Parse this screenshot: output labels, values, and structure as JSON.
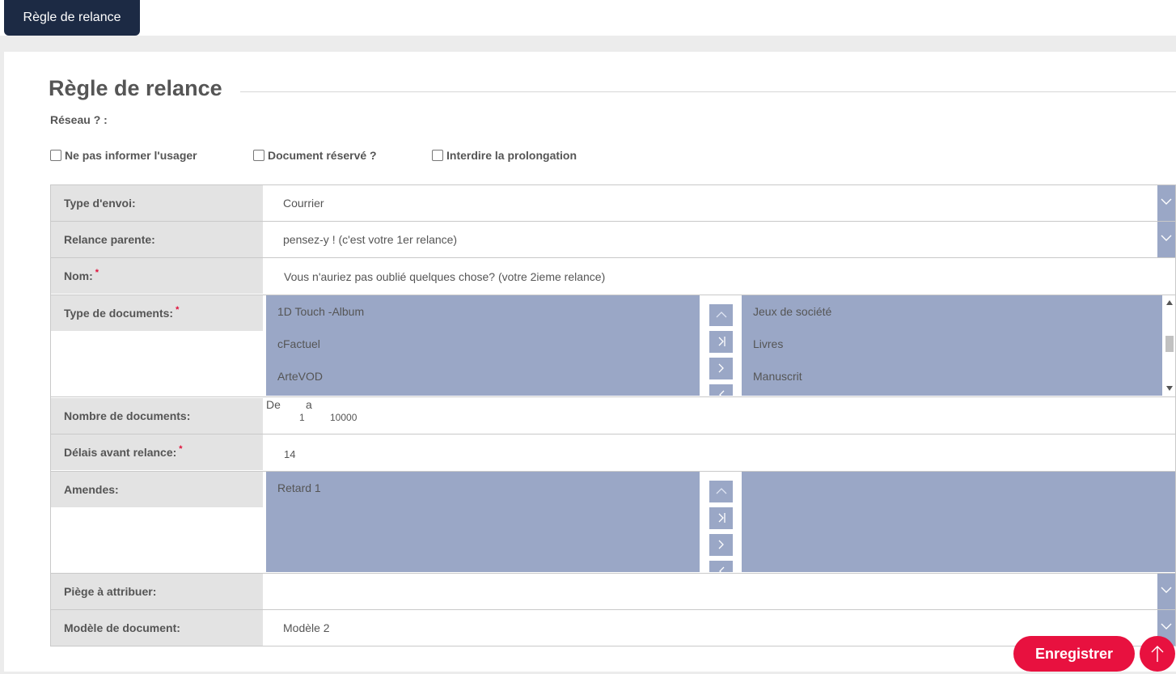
{
  "tab": {
    "label": "Règle de relance"
  },
  "page": {
    "title": "Règle de relance",
    "reseau_label": "Réseau ? :"
  },
  "checkboxes": [
    {
      "label": "Ne pas informer l'usager",
      "checked": false
    },
    {
      "label": "Document réservé ?",
      "checked": false
    },
    {
      "label": "Interdire la prolongation",
      "checked": false
    }
  ],
  "fields": {
    "type_envoi": {
      "label": "Type d'envoi:",
      "value": "Courrier"
    },
    "relance_parente": {
      "label": "Relance parente:",
      "value": "pensez-y !  (c'est votre 1er relance)"
    },
    "nom": {
      "label": "Nom:",
      "required": "*",
      "value": "Vous n'auriez pas oublié quelques chose?  (votre 2ieme relance)"
    },
    "type_documents": {
      "label": "Type de documents:",
      "required": "*",
      "available": [
        "1D Touch -Album",
        "cFactuel",
        "ArteVOD"
      ],
      "selected": [
        "Jeux de société",
        "Livres",
        "Manuscrit"
      ]
    },
    "nombre_documents": {
      "label": "Nombre de documents:",
      "from_label": "De",
      "to_label": "a",
      "from_value": "1",
      "to_value": "10000"
    },
    "delais": {
      "label": "Délais avant relance:",
      "required": "*",
      "value": "14"
    },
    "amendes": {
      "label": "Amendes:",
      "available": [
        "Retard 1"
      ],
      "selected": []
    },
    "piege": {
      "label": "Piège à attribuer:",
      "value": ""
    },
    "modele": {
      "label": "Modèle de document:",
      "value": "Modèle 2"
    }
  },
  "actions": {
    "save_label": "Enregistrer"
  },
  "colors": {
    "navy": "#1c2a44",
    "accent": "#e8113f",
    "list_bg": "#9aa7c6",
    "label_bg": "#e3e3e3"
  }
}
